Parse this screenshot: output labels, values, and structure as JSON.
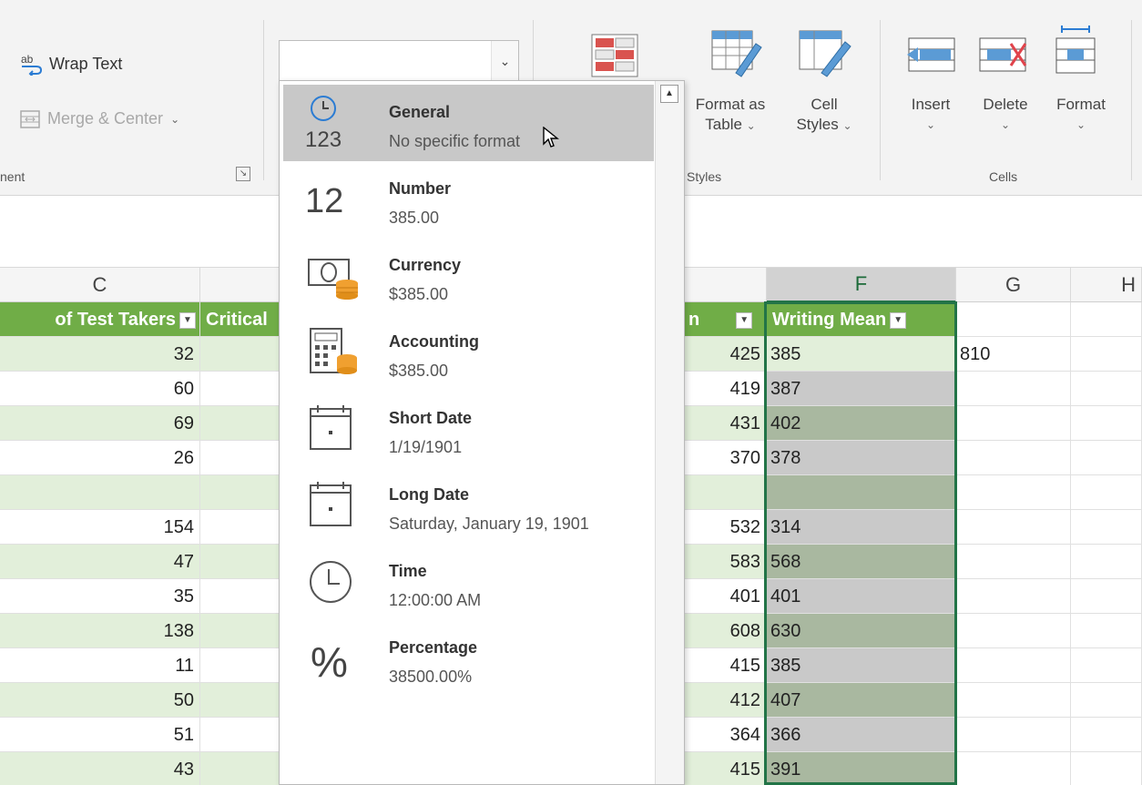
{
  "ribbon": {
    "wrap_text": "Wrap Text",
    "wrap_icon_text": "ab",
    "merge_center": "Merge & Center",
    "alignment_group": "nent",
    "format_as_table": [
      "Format as",
      "Table"
    ],
    "cell_styles": [
      "Cell",
      "Styles"
    ],
    "styles_group": "Styles",
    "insert": "Insert",
    "delete": "Delete",
    "format": "Format",
    "cells_group": "Cells",
    "number_format_value": ""
  },
  "grid": {
    "columns": [
      "C",
      "F",
      "G",
      "H"
    ],
    "headers": {
      "c": "of Test Takers",
      "d": "Critical",
      "e": "n",
      "f": "Writing Mean"
    },
    "rows": [
      {
        "c": "32",
        "e": "425",
        "f": "385",
        "g": "810"
      },
      {
        "c": "60",
        "e": "419",
        "f": "387",
        "g": ""
      },
      {
        "c": "69",
        "e": "431",
        "f": "402",
        "g": ""
      },
      {
        "c": "26",
        "e": "370",
        "f": "378",
        "g": ""
      },
      {
        "c": "",
        "e": "",
        "f": "",
        "g": ""
      },
      {
        "c": "154",
        "e": "532",
        "f": "314",
        "g": ""
      },
      {
        "c": "47",
        "e": "583",
        "f": "568",
        "g": ""
      },
      {
        "c": "35",
        "e": "401",
        "f": "401",
        "g": ""
      },
      {
        "c": "138",
        "e": "608",
        "f": "630",
        "g": ""
      },
      {
        "c": "11",
        "e": "415",
        "f": "385",
        "g": ""
      },
      {
        "c": "50",
        "e": "412",
        "f": "407",
        "g": ""
      },
      {
        "c": "51",
        "e": "364",
        "f": "366",
        "g": ""
      },
      {
        "c": "43",
        "e": "415",
        "f": "391",
        "g": ""
      }
    ]
  },
  "number_format_menu": {
    "items": [
      {
        "name": "General",
        "sample": "No specific format",
        "icon": "general-clock-123-icon",
        "icon_text": "123"
      },
      {
        "name": "Number",
        "sample": "385.00",
        "icon": "number-icon",
        "icon_text": "12"
      },
      {
        "name": "Currency",
        "sample": "$385.00",
        "icon": "currency-icon"
      },
      {
        "name": "Accounting",
        "sample": " $385.00",
        "icon": "accounting-icon"
      },
      {
        "name": "Short Date",
        "sample": "1/19/1901",
        "icon": "calendar-icon"
      },
      {
        "name": "Long Date",
        "sample": "Saturday, January 19, 1901",
        "icon": "calendar-icon"
      },
      {
        "name": "Time",
        "sample": "12:00:00 AM",
        "icon": "clock-icon"
      },
      {
        "name": "Percentage",
        "sample": "38500.00%",
        "icon": "percent-icon",
        "icon_text": "%"
      }
    ]
  },
  "colors": {
    "table_header": "#70ad47",
    "row_light": "#e2efda",
    "row_white": "#ffffff",
    "highlight_grey": "#c9c9c9",
    "highlight_green": "#a9b8a0",
    "selection_border": "#227447"
  }
}
